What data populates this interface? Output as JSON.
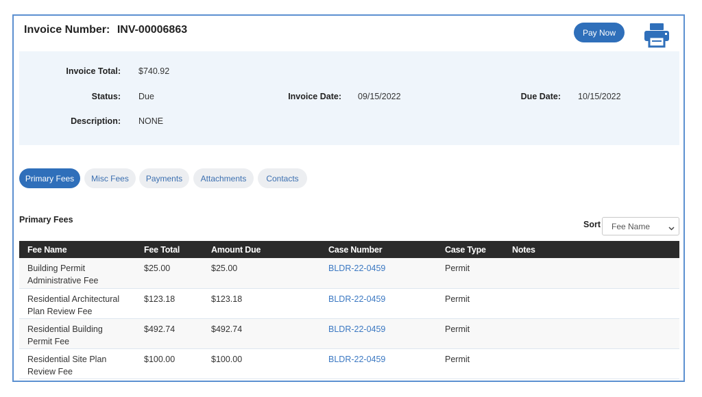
{
  "header": {
    "invoice_number_label": "Invoice Number:",
    "invoice_number": "INV-00006863",
    "pay_now_label": "Pay Now",
    "print_icon": "printer-icon"
  },
  "summary": {
    "invoice_total_label": "Invoice Total:",
    "invoice_total": "$740.92",
    "status_label": "Status:",
    "status": "Due",
    "invoice_date_label": "Invoice Date:",
    "invoice_date": "09/15/2022",
    "due_date_label": "Due Date:",
    "due_date": "10/15/2022",
    "description_label": "Description:",
    "description": "NONE"
  },
  "tabs": [
    {
      "label": "Primary Fees",
      "active": true
    },
    {
      "label": "Misc Fees",
      "active": false
    },
    {
      "label": "Payments",
      "active": false
    },
    {
      "label": "Attachments",
      "active": false
    },
    {
      "label": "Contacts",
      "active": false
    }
  ],
  "section": {
    "title": "Primary Fees",
    "sort_label": "Sort",
    "sort_value": "Fee Name"
  },
  "table": {
    "columns": [
      "Fee Name",
      "Fee Total",
      "Amount Due",
      "Case Number",
      "Case Type",
      "Notes"
    ],
    "rows": [
      {
        "fee_name_1": "Building Permit",
        "fee_name_2": "Administrative Fee",
        "fee_total": "$25.00",
        "amount_due": "$25.00",
        "case_number": "BLDR-22-0459",
        "case_type": "Permit",
        "notes": ""
      },
      {
        "fee_name_1": "Residential Architectural",
        "fee_name_2": "Plan Review Fee",
        "fee_total": "$123.18",
        "amount_due": "$123.18",
        "case_number": "BLDR-22-0459",
        "case_type": "Permit",
        "notes": ""
      },
      {
        "fee_name_1": "Residential Building",
        "fee_name_2": "Permit Fee",
        "fee_total": "$492.74",
        "amount_due": "$492.74",
        "case_number": "BLDR-22-0459",
        "case_type": "Permit",
        "notes": ""
      },
      {
        "fee_name_1": "Residential Site Plan",
        "fee_name_2": "Review Fee",
        "fee_total": "$100.00",
        "amount_due": "$100.00",
        "case_number": "BLDR-22-0459",
        "case_type": "Permit",
        "notes": ""
      }
    ]
  },
  "colors": {
    "accent": "#2f6fba",
    "frame_border": "#5b8fd0",
    "summary_bg": "#eff5fb",
    "table_header_bg": "#2b2b2b",
    "link": "#3b78c2"
  }
}
